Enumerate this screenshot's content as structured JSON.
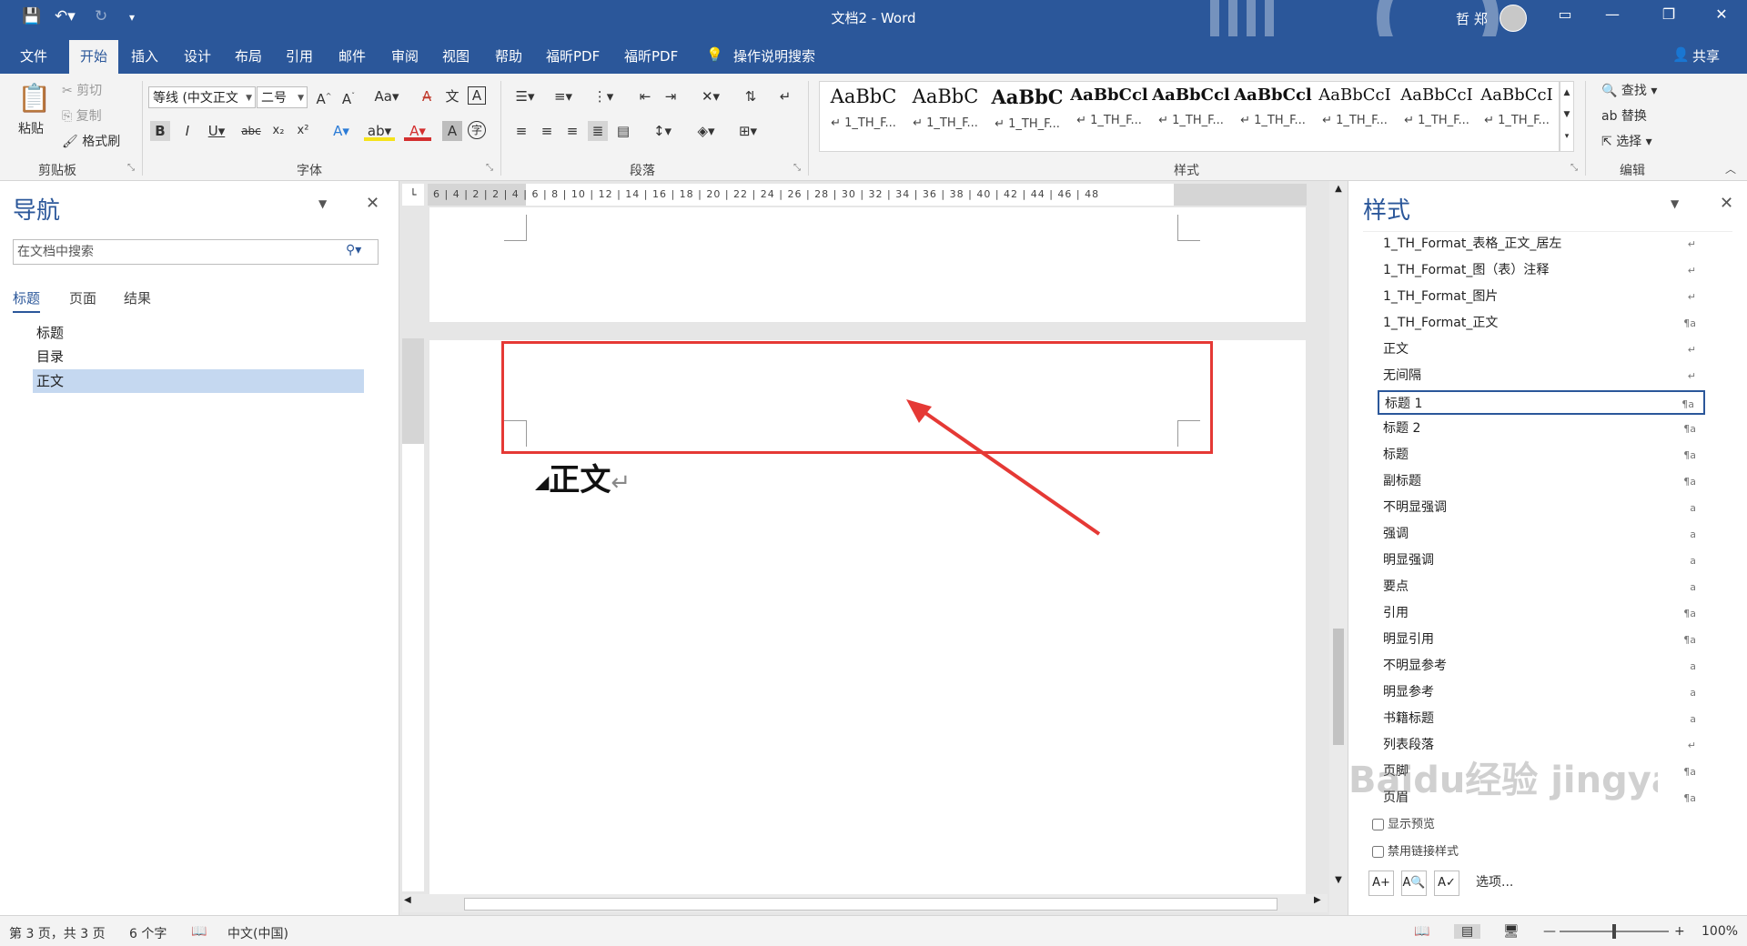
{
  "window": {
    "doc_title": "文档2 - Word",
    "user_name": "哲 郑"
  },
  "menu_tabs": [
    "文件",
    "开始",
    "插入",
    "设计",
    "布局",
    "引用",
    "邮件",
    "审阅",
    "视图",
    "帮助",
    "福昕PDF",
    "福昕PDF"
  ],
  "tell_me": "操作说明搜索",
  "share": "共享",
  "ribbon": {
    "clipboard": {
      "paste": "粘贴",
      "cut": "剪切",
      "copy": "复制",
      "format_painter": "格式刷",
      "label": "剪贴板"
    },
    "font": {
      "name": "等线 (中文正文",
      "size": "二号",
      "label": "字体"
    },
    "paragraph": {
      "label": "段落"
    },
    "styles": {
      "label": "样式",
      "gallery": [
        {
          "sample": "AaBbC",
          "name": "↵ 1_TH_F..."
        },
        {
          "sample": "AaBbC",
          "name": "↵ 1_TH_F..."
        },
        {
          "sample": "AaBbC",
          "name": "↵ 1_TH_F..."
        },
        {
          "sample": "AaBbCcl",
          "name": "↵ 1_TH_F..."
        },
        {
          "sample": "AaBbCcl",
          "name": "↵ 1_TH_F..."
        },
        {
          "sample": "AaBbCcl",
          "name": "↵ 1_TH_F..."
        },
        {
          "sample": "AaBbCcI",
          "name": "↵ 1_TH_F..."
        },
        {
          "sample": "AaBbCcI",
          "name": "↵ 1_TH_F..."
        },
        {
          "sample": "AaBbCcI",
          "name": "↵ 1_TH_F..."
        }
      ]
    },
    "editing": {
      "find": "查找",
      "replace": "替换",
      "select": "选择",
      "label": "编辑"
    }
  },
  "nav_pane": {
    "title": "导航",
    "search_placeholder": "在文档中搜索",
    "tabs": [
      "标题",
      "页面",
      "结果"
    ],
    "items": [
      "标题",
      "目录",
      "正文"
    ]
  },
  "document": {
    "heading_text": "正文",
    "ruler_h": "6 | 4 | 2 | 2 | 4 | 6 | 8 | 10 | 12 | 14 | 16 | 18 | 20 | 22 | 24 | 26 | 28 | 30 | 32 | 34 | 36 | 38 | 40 | 42 | 44 | 46 | 48"
  },
  "styles_pane": {
    "title": "样式",
    "items": [
      {
        "name": "1_TH_Format_表格_正文_居左",
        "mark": "↵"
      },
      {
        "name": "1_TH_Format_图（表）注释",
        "mark": "↵"
      },
      {
        "name": "1_TH_Format_图片",
        "mark": "↵"
      },
      {
        "name": "1_TH_Format_正文",
        "mark": "¶a"
      },
      {
        "name": "正文",
        "mark": "↵"
      },
      {
        "name": "无间隔",
        "mark": "↵"
      },
      {
        "name": "标题 1",
        "mark": "¶a"
      },
      {
        "name": "标题 2",
        "mark": "¶a"
      },
      {
        "name": "标题",
        "mark": "¶a"
      },
      {
        "name": "副标题",
        "mark": "¶a"
      },
      {
        "name": "不明显强调",
        "mark": "a"
      },
      {
        "name": "强调",
        "mark": "a"
      },
      {
        "name": "明显强调",
        "mark": "a"
      },
      {
        "name": "要点",
        "mark": "a"
      },
      {
        "name": "引用",
        "mark": "¶a"
      },
      {
        "name": "明显引用",
        "mark": "¶a"
      },
      {
        "name": "不明显参考",
        "mark": "a"
      },
      {
        "name": "明显参考",
        "mark": "a"
      },
      {
        "name": "书籍标题",
        "mark": "a"
      },
      {
        "name": "列表段落",
        "mark": "↵"
      },
      {
        "name": "页脚",
        "mark": "¶a"
      },
      {
        "name": "页眉",
        "mark": "¶a"
      }
    ],
    "show_preview": "显示预览",
    "disable_linked": "禁用链接样式",
    "options": "选项..."
  },
  "status": {
    "page": "第 3 页，共 3 页",
    "words": "6 个字",
    "language": "中文(中国)",
    "zoom": "100%"
  },
  "watermark": "Baidu经验 jingyan.baidu.com",
  "colors": {
    "accent": "#2b579a",
    "highlight_box": "#e53935",
    "selected_nav": "#c5d8f0"
  }
}
